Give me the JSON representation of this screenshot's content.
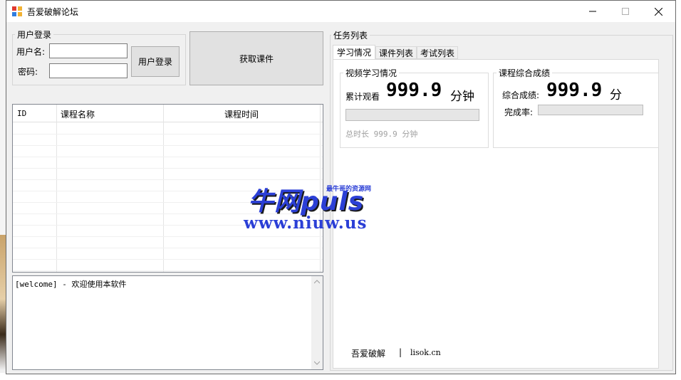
{
  "window": {
    "title": "吾爱破解论坛",
    "minimize": "—",
    "maximize": "☐",
    "close": "✕"
  },
  "login": {
    "group_title": "用户登录",
    "username_label": "用户名:",
    "username_value": "",
    "password_label": "密码:",
    "password_value": "",
    "login_button": "用户登录"
  },
  "fetch_button": "获取课件",
  "grid": {
    "columns": [
      "ID",
      "课程名称",
      "课程时间"
    ],
    "rows": []
  },
  "log": {
    "text": "[welcome] - 欢迎使用本软件"
  },
  "tasks": {
    "group_title": "任务列表",
    "tabs": [
      "学习情况",
      "课件列表",
      "考试列表"
    ],
    "active_tab": 0,
    "video": {
      "title": "视频学习情况",
      "watched_label": "累计观看",
      "watched_value": "999.9",
      "watched_unit": "分钟",
      "progress": 0,
      "total_text": "总时长 999.9 分钟"
    },
    "score": {
      "title": "课程综合成绩",
      "score_label": "综合成绩:",
      "score_value": "999.9",
      "score_unit": "分",
      "completion_label": "完成率:",
      "completion_progress": 0
    },
    "footer": {
      "left": "吾爱破解",
      "sep": "|",
      "right": "lisok.cn"
    }
  },
  "watermark": {
    "brand": "牛网puls",
    "tagline": "最牛哥的资源网",
    "url": "www.niuw.us"
  },
  "colors": {
    "accent_blue": "#2b3fd6",
    "watermark_dark": "#1a1a1a"
  }
}
